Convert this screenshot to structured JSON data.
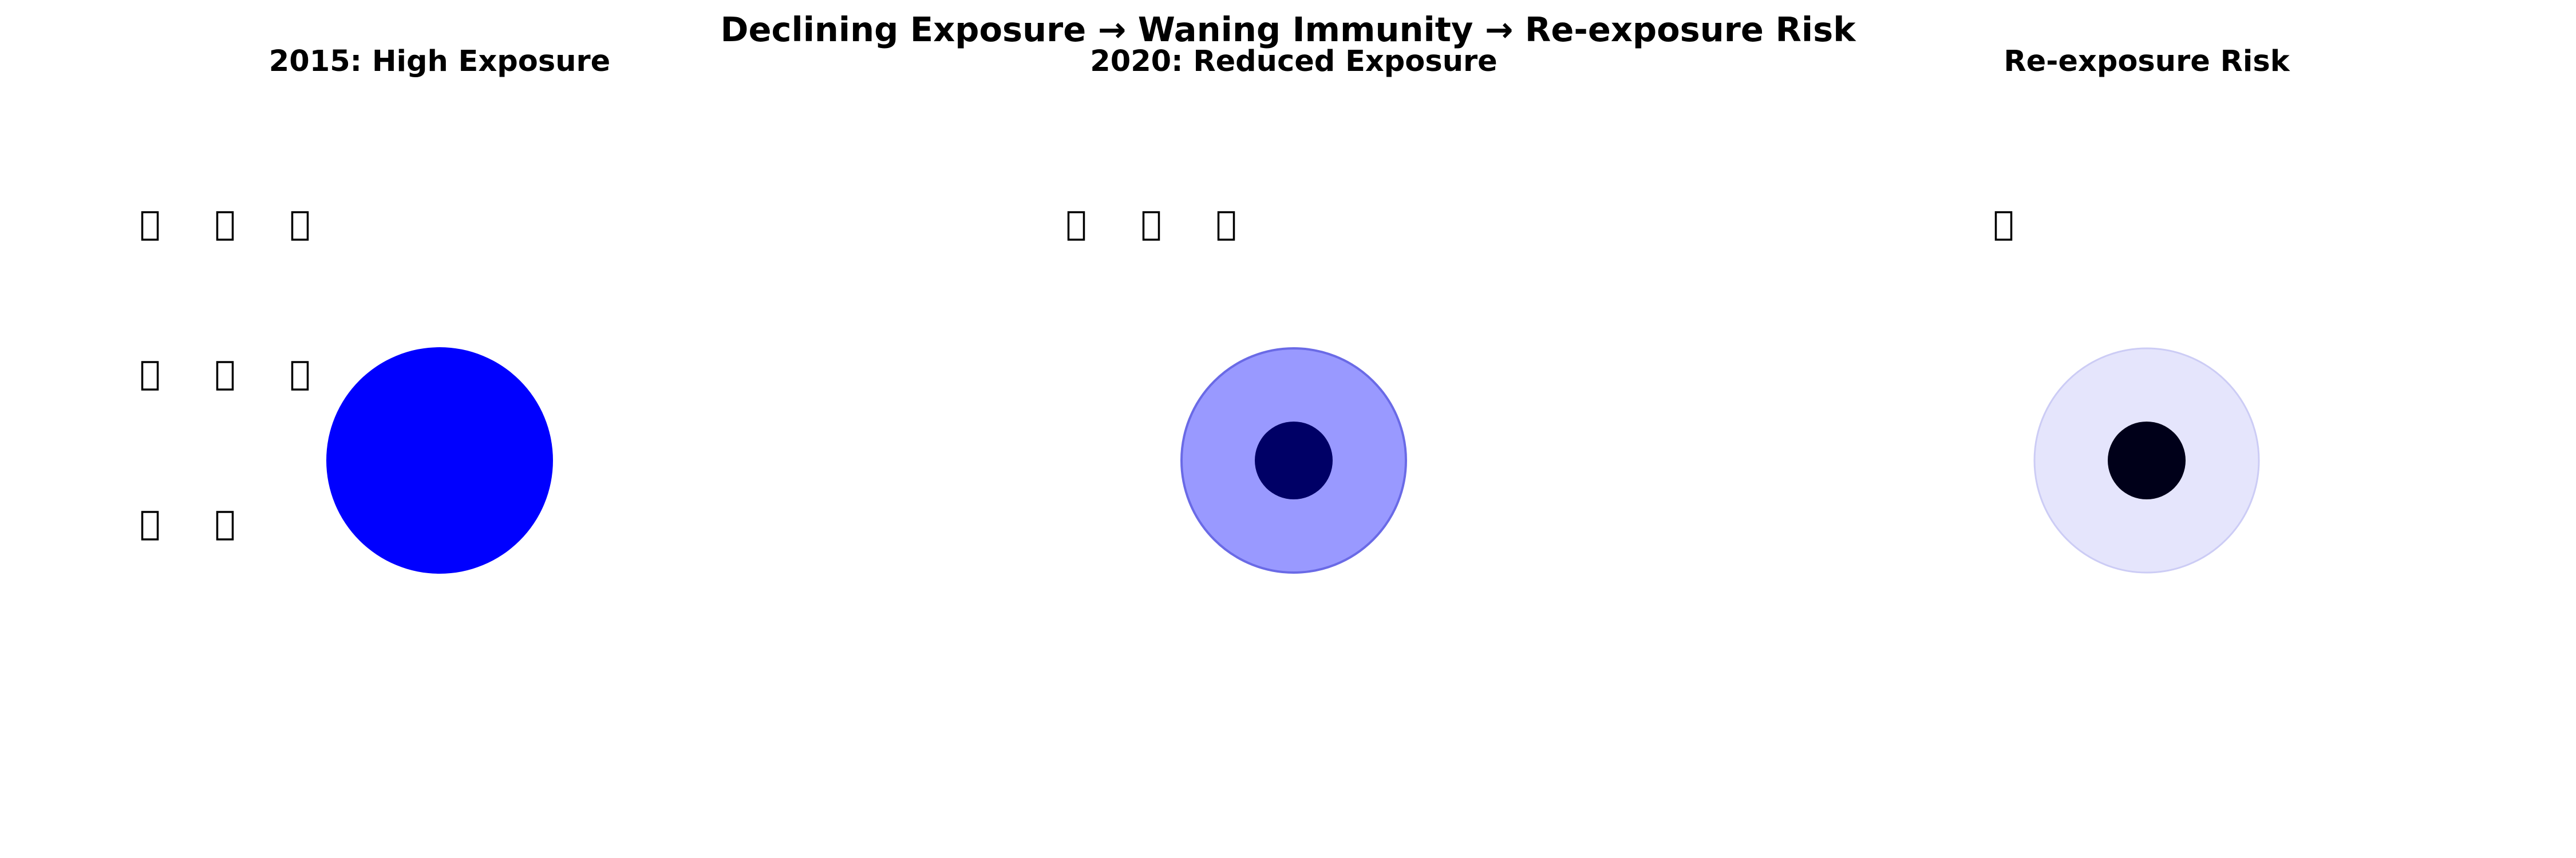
{
  "title": "Declining Exposure → Waning Immunity → Re-exposure Risk",
  "colors": {
    "glyph_box": "#000000",
    "panel1_circle": "#0000ff",
    "panel2_circle_fill": "#9999ff",
    "panel2_circle_stroke": "#6a6ae6",
    "panel2_core": "#000066",
    "panel3_circle_fill": "#e5e5fc",
    "panel3_circle_stroke": "#ccccf5",
    "panel3_core": "#000019"
  },
  "panels": [
    {
      "title": "2015: High Exposure",
      "exposure_glyph_count": 8,
      "circle_icon": "immunity-circle",
      "has_core": false
    },
    {
      "title": "2020: Reduced Exposure",
      "exposure_glyph_count": 3,
      "circle_icon": "immunity-circle",
      "has_core": true
    },
    {
      "title": "Re-exposure Risk",
      "exposure_glyph_count": 1,
      "circle_icon": "immunity-circle",
      "has_core": true
    }
  ]
}
